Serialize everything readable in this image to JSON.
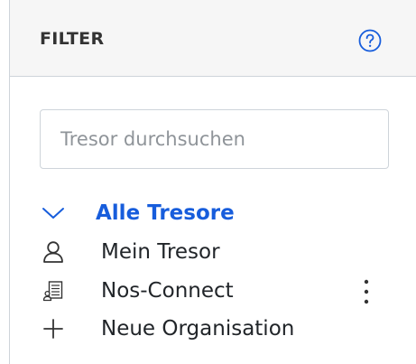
{
  "panel": {
    "title": "FILTER",
    "help_icon": "question-circle-icon"
  },
  "search": {
    "placeholder": "Tresor durchsuchen",
    "value": ""
  },
  "tree": {
    "all_vaults": {
      "label": "Alle Tresore",
      "icon": "chevron-down-icon",
      "expanded": true
    },
    "items": [
      {
        "label": "Mein Tresor",
        "icon": "user-icon"
      },
      {
        "label": "Nos-Connect",
        "icon": "organization-icon",
        "has_menu": true
      },
      {
        "label": "Neue Organisation",
        "icon": "plus-icon"
      }
    ]
  },
  "colors": {
    "accent": "#175ddc",
    "header_bg": "#f6f6f6",
    "border": "#ced4da",
    "text": "#212529"
  }
}
